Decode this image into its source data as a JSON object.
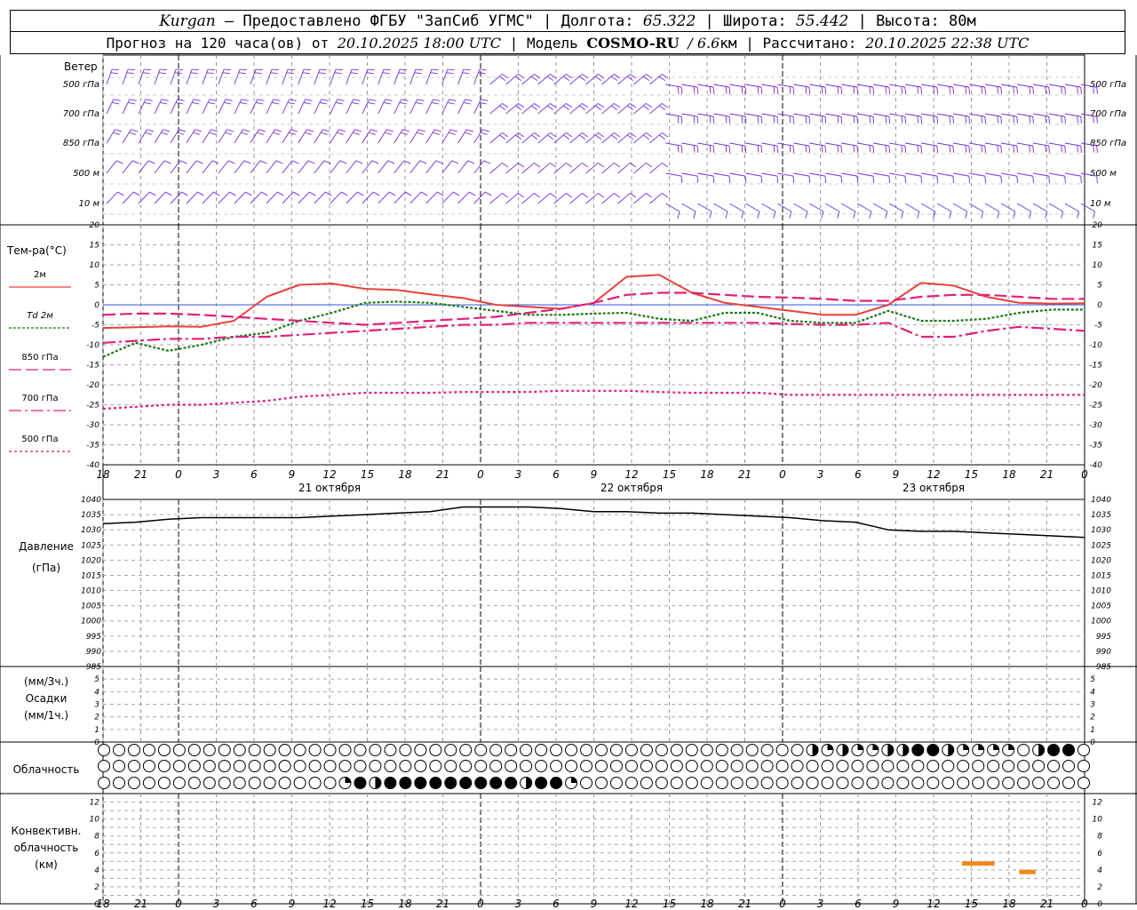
{
  "header": {
    "city": "Kurgan",
    "provider": "— Предоставлено ФГБУ \"ЗапСиб УГМС\" |",
    "lon_label": "Долгота:",
    "lon": "65.322",
    "lat_label": "| Широта:",
    "lat": "55.442",
    "alt_label": "| Высота: 80м",
    "forecast_label": "Прогноз на 120 часа(ов) от",
    "forecast_time": "20.10.2025 18:00 UTC",
    "model_label": "| Модель",
    "model": "COSMO-RU",
    "model_res": "/ 6.6",
    "model_unit": "км | Рассчитано:",
    "calc_time": "20.10.2025 22:38 UTC"
  },
  "wind": {
    "title": "Ветер",
    "levels": [
      "500 гПа",
      "700 гПа",
      "850 гПа",
      "500 м",
      "10 м"
    ],
    "color": "#7a2ed6"
  },
  "temp_panel": {
    "title": "Тем-ра(°C)",
    "legend": [
      "2м",
      "Td 2м",
      "850 гПа",
      "700 гПа",
      "500 гПа"
    ],
    "ticks": [
      "20",
      "15",
      "10",
      "5",
      "0",
      "-5",
      "-10",
      "-15",
      "-20",
      "-25",
      "-30",
      "-35",
      "-40"
    ]
  },
  "pressure_panel": {
    "title": "Давление",
    "unit": "(гПа)",
    "ticks": [
      "1040",
      "1035",
      "1030",
      "1025",
      "1020",
      "1015",
      "1010",
      "1005",
      "1000",
      "995",
      "990",
      "985"
    ]
  },
  "precip_panel": {
    "unit1": "(мм/3ч.)",
    "title": "Осадки",
    "unit2": "(мм/1ч.)",
    "ticks": [
      "5",
      "4",
      "3",
      "2",
      "1",
      "0"
    ]
  },
  "cloud_panel": {
    "title": "Облачность"
  },
  "conv_panel": {
    "title1": "Конвективн.",
    "title2": "облачность",
    "unit": "(км)",
    "ticks": [
      "12",
      "10",
      "8",
      "6",
      "4",
      "2",
      "0"
    ]
  },
  "x_ticks": [
    "18",
    "21",
    "0",
    "3",
    "6",
    "9",
    "12",
    "15",
    "18",
    "21",
    "0",
    "3",
    "6",
    "9",
    "12",
    "15",
    "18",
    "21",
    "0",
    "3",
    "6",
    "9",
    "12",
    "15",
    "18",
    "21",
    "0"
  ],
  "dates": [
    "21 октября",
    "22 октября",
    "23 октября"
  ],
  "chart_data": {
    "type": "line",
    "x_hours": [
      0,
      3,
      6,
      9,
      12,
      15,
      18,
      21,
      24,
      27,
      30,
      33,
      36,
      39,
      42,
      45,
      48,
      51,
      54,
      57,
      60,
      63,
      66,
      69,
      72,
      75,
      78
    ],
    "series": [
      {
        "name": "2м",
        "color": "#e8413c",
        "dash": "",
        "values": [
          -5.8,
          -5.6,
          -5.4,
          -5.5,
          -4,
          2,
          5,
          5.3,
          4,
          3.7,
          2.6,
          1.7,
          0,
          -0.5,
          -1,
          0.5,
          7,
          7.5,
          3,
          0.5,
          -0.5,
          -1.5,
          -2.5,
          -2.5,
          0,
          5.5,
          4.8,
          2,
          0.5,
          0.3,
          0.4
        ]
      },
      {
        "name": "Td 2м",
        "color": "#1a7a1a",
        "dash": "3,2",
        "values": [
          -13,
          -9.5,
          -11.5,
          -10,
          -8,
          -7,
          -4,
          -2,
          0.5,
          0.8,
          0.5,
          -0.5,
          -1.5,
          -2.5,
          -2.5,
          -2.2,
          -2,
          -3.5,
          -4,
          -2,
          -2,
          -4,
          -4.5,
          -4.5,
          -1.5,
          -4,
          -4,
          -3.5,
          -2,
          -1.2,
          -1.2
        ]
      },
      {
        "name": "850 гПа",
        "color": "#e0207a",
        "dash": "14,5",
        "values": [
          -2.5,
          -2.2,
          -2.2,
          -2.5,
          -3,
          -3.5,
          -4,
          -4.5,
          -5,
          -4.5,
          -4,
          -3.5,
          -3,
          -2,
          -1,
          0.5,
          2.5,
          3,
          3,
          2.5,
          2,
          1.8,
          1.5,
          1,
          1,
          2,
          2.5,
          2.5,
          2,
          1.5,
          1.5
        ]
      },
      {
        "name": "700 гПа",
        "color": "#e0207a",
        "dash": "14,4,3,4",
        "values": [
          -9.5,
          -9,
          -8.5,
          -8.5,
          -8,
          -8,
          -7.5,
          -7,
          -6.5,
          -6,
          -5.5,
          -5,
          -5,
          -4.5,
          -4.5,
          -4.5,
          -4.5,
          -4.5,
          -4.5,
          -4.5,
          -4.5,
          -4.8,
          -5,
          -5,
          -4.5,
          -8,
          -8,
          -6.5,
          -5.5,
          -6,
          -6.5
        ]
      },
      {
        "name": "500 гПа",
        "color": "#e0207a",
        "dash": "3,3",
        "values": [
          -26,
          -25.5,
          -25,
          -25,
          -24.5,
          -24,
          -23,
          -22.5,
          -22,
          -22,
          -22,
          -21.8,
          -21.8,
          -21.8,
          -21.5,
          -21.5,
          -21.5,
          -21.8,
          -22,
          -22,
          -22,
          -22.5,
          -22.5,
          -22.5,
          -22.5,
          -22.5,
          -22.5,
          -22.5,
          -22.5,
          -22.5,
          -22.5
        ]
      },
      {
        "name": "Давление",
        "color": "#000000",
        "dash": "",
        "values": [
          1032,
          1032.5,
          1033.5,
          1034,
          1034,
          1034,
          1034,
          1034.5,
          1035,
          1035.5,
          1036,
          1037.5,
          1037.5,
          1037.5,
          1037,
          1036,
          1036,
          1035.5,
          1035.5,
          1035,
          1034.5,
          1034,
          1033,
          1032.5,
          1030,
          1029.5,
          1029.5,
          1029,
          1028.5,
          1028,
          1027.5
        ]
      }
    ],
    "x_series_hours": [
      0,
      3,
      6,
      9,
      12,
      15,
      18,
      21,
      24,
      27,
      30,
      33,
      36,
      39,
      42,
      45,
      48,
      51,
      54,
      57,
      60,
      63,
      66,
      69,
      72,
      75,
      78,
      81,
      84,
      87,
      90
    ],
    "temp_ylim": [
      -40,
      20
    ],
    "pressure_ylim": [
      985,
      1040
    ],
    "precip_ylim": [
      0,
      5
    ],
    "conv_ylim": [
      0,
      13
    ],
    "conv_bars": [
      {
        "start_hour": 105,
        "end_hour": 107,
        "value": 4.7
      },
      {
        "start_hour": 107,
        "end_hour": 109,
        "value": 4.7
      },
      {
        "start_hour": 112,
        "end_hour": 114,
        "value": 3.7
      }
    ],
    "cloud_rows": {
      "high": "000000000000000000000000000000000000000000000002121122332111102330333333333331033333333",
      "middle": "000000000000000000000000000000000000000000000000000000000000000000000000033333300012233333333",
      "low": "000000000000000013233333333323310000000000000000000000000000000000000000000000000000000000000"
    }
  }
}
